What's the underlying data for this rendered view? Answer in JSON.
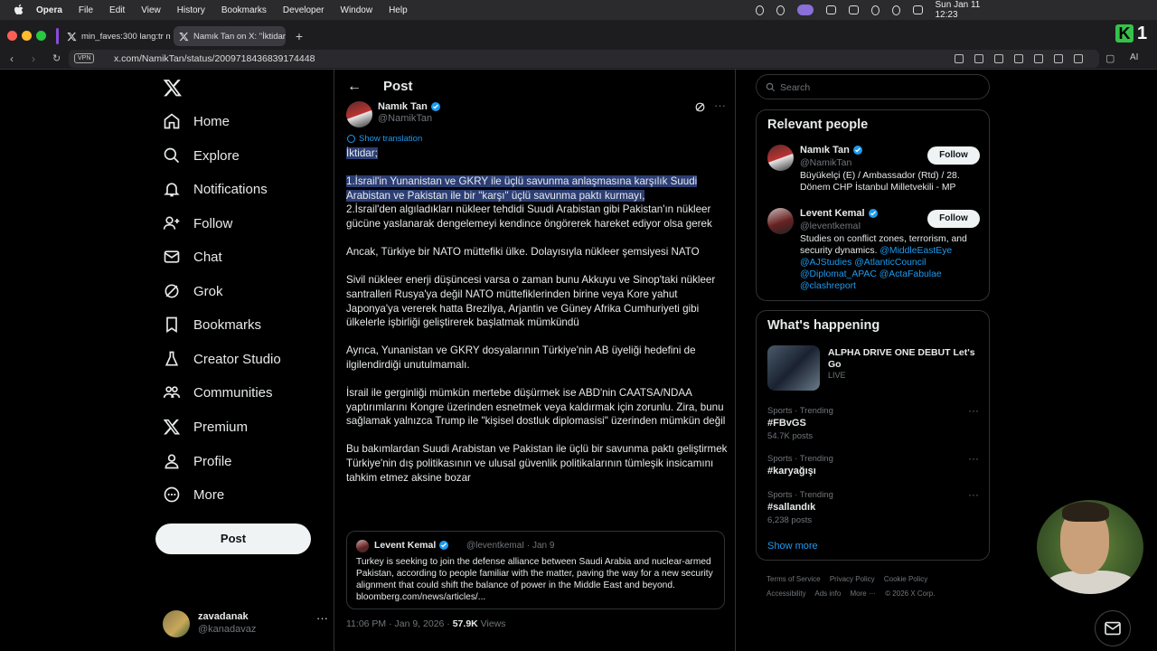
{
  "menubar": {
    "app": "Opera",
    "items": [
      "File",
      "Edit",
      "View",
      "History",
      "Bookmarks",
      "Developer",
      "Window",
      "Help"
    ],
    "clock": "Sun Jan 11  12:23"
  },
  "tabs": [
    {
      "label": "min_faves:300 lang:tr m"
    },
    {
      "label": "Namık Tan on X: \"İktidar"
    }
  ],
  "address": {
    "vpn": "VPN",
    "url": "x.com/NamikTan/status/2009718436839174448",
    "ai": "AI"
  },
  "sidebar": {
    "items": [
      {
        "label": "Home",
        "icon": "home-icon"
      },
      {
        "label": "Explore",
        "icon": "search-icon"
      },
      {
        "label": "Notifications",
        "icon": "bell-icon"
      },
      {
        "label": "Follow",
        "icon": "add-person-icon"
      },
      {
        "label": "Chat",
        "icon": "mail-icon"
      },
      {
        "label": "Grok",
        "icon": "grok-icon"
      },
      {
        "label": "Bookmarks",
        "icon": "bookmark-icon"
      },
      {
        "label": "Creator Studio",
        "icon": "flask-icon"
      },
      {
        "label": "Communities",
        "icon": "people-icon"
      },
      {
        "label": "Premium",
        "icon": "x-icon"
      },
      {
        "label": "Profile",
        "icon": "person-icon"
      },
      {
        "label": "More",
        "icon": "more-circle-icon"
      }
    ],
    "post_label": "Post",
    "account": {
      "name": "zavadanak",
      "handle": "@kanadavaz"
    }
  },
  "post": {
    "header_title": "Post",
    "author_name": "Namık Tan",
    "author_handle": "@NamikTan",
    "show_translation": "Show translation",
    "paragraphs": [
      "İktidar;",
      "1.İsrail'in Yunanistan ve GKRY ile üçlü savunma anlaşmasına karşılık Suudi Arabistan ve Pakistan ile bir \"karşı\" üçlü savunma paktı kurmayı,",
      "2.İsrail'den algıladıkları nükleer tehdidi Suudi Arabistan gibi Pakistan'ın nükleer gücüne yaslanarak dengelemeyi kendince öngörerek hareket ediyor olsa gerek",
      "Ancak, Türkiye bir NATO müttefiki ülke. Dolayısıyla nükleer şemsiyesi NATO",
      "Sivil nükleer enerji düşüncesi varsa o zaman bunu Akkuyu ve Sinop'taki nükleer santralleri Rusya'ya değil NATO müttefiklerinden birine veya Kore yahut Japonya'ya vererek hatta Brezilya, Arjantin ve Güney Afrika Cumhuriyeti gibi ülkelerle işbirliği geliştirerek başlatmak mümkündü",
      "Ayrıca, Yunanistan ve GKRY dosyalarının Türkiye'nin AB üyeliği hedefini de ilgilendirdiği unutulmamalı.",
      "İsrail ile gerginliği mümkün mertebe düşürmek ise ABD'nin CAATSA/NDAA yaptırımlarını Kongre üzerinden esnetmek veya kaldırmak için zorunlu. Zira, bunu sağlamak yalnızca Trump ile \"kişisel dostluk diplomasisi\" üzerinden mümkün değil",
      "Bu bakımlardan Suudi Arabistan ve Pakistan ile üçlü bir savunma paktı geliştirmek Türkiye'nin dış politikasının ve ulusal güvenlik politikalarının tümleşik insicamını tahkim etmez aksine bozar"
    ],
    "quote": {
      "name": "Levent Kemal",
      "handle_date": "@leventkemaI · Jan 9",
      "text": "Turkey is seeking to join the defense alliance between Saudi Arabia and nuclear-armed Pakistan, according to people familiar with the matter, paving the way for a new security alignment that could shift the balance of power in the Middle East and beyond. bloomberg.com/news/articles/..."
    },
    "time": "11:06 PM · Jan 9, 2026 · ",
    "views_count": "57.9K",
    "views_label": " Views"
  },
  "right": {
    "search_placeholder": "Search",
    "relevant_title": "Relevant people",
    "people": [
      {
        "name": "Namık Tan",
        "handle": "@NamikTan",
        "bio": "Büyükelçi (E) / Ambassador (Rtd) / 28. Dönem CHP İstanbul Milletvekili - MP",
        "follow": "Follow"
      },
      {
        "name": "Levent Kemal",
        "handle": "@leventkemaI",
        "bio": "Studies on conflict zones, terrorism, and security dynamics.",
        "links": "@MiddleEastEye @AJStudies @AtlanticCouncil @Diplomat_APAC @ActaFabulae @clashreport",
        "follow": "Follow"
      }
    ],
    "happening_title": "What's happening",
    "event": {
      "title": "ALPHA DRIVE ONE DEBUT Let's Go",
      "status": "LIVE"
    },
    "trends": [
      {
        "category": "Sports · Trending",
        "tag": "#FBvGS",
        "posts": "54.7K posts"
      },
      {
        "category": "Sports · Trending",
        "tag": "#karyağışı",
        "posts": ""
      },
      {
        "category": "Sports · Trending",
        "tag": "#sallandık",
        "posts": "6,238 posts"
      }
    ],
    "show_more": "Show more",
    "footer": [
      "Terms of Service",
      "Privacy Policy",
      "Cookie Policy",
      "Accessibility",
      "Ads info",
      "More ···",
      "© 2026 X Corp."
    ]
  }
}
